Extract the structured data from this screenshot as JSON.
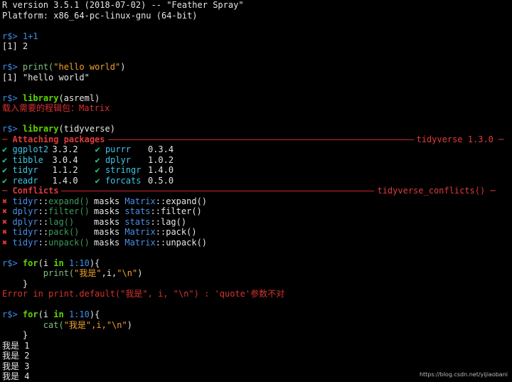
{
  "banner": {
    "version_line": "R version 3.5.1 (2018-07-02) -- \"Feather Spray\"",
    "platform_line": "Platform: x86_64-pc-linux-gnu (64-bit)"
  },
  "prompt": "r$>",
  "session": {
    "cmd1": "1+1",
    "out1": "[1] 2",
    "cmd2_fn": "print(",
    "cmd2_str": "\"hello world\"",
    "cmd2_close": ")",
    "out2": "[1] \"hello world\"",
    "cmd3_fn": "library",
    "cmd3_arg": "(asreml)",
    "out3_msg": "载入需要的程辑包：Matrix",
    "cmd4_fn": "library",
    "cmd4_arg": "(tidyverse)"
  },
  "attaching": {
    "title": "─ Attaching packages",
    "right": "tidyverse 1.3.0 ─",
    "check": "✔",
    "packages": [
      {
        "name": "ggplot2",
        "version": "3.3.2"
      },
      {
        "name": "tibble",
        "version": "3.0.4"
      },
      {
        "name": "tidyr",
        "version": "1.1.2"
      },
      {
        "name": "readr",
        "version": "1.4.0"
      },
      {
        "name": "purrr",
        "version": "0.3.4"
      },
      {
        "name": "dplyr",
        "version": "1.0.2"
      },
      {
        "name": "stringr",
        "version": "1.4.0"
      },
      {
        "name": "forcats",
        "version": "0.5.0"
      }
    ]
  },
  "conflicts": {
    "title": "─ Conflicts",
    "right": "tidyverse_conflicts() ─",
    "cross": "✖",
    "masks_word": "masks",
    "rows": [
      {
        "pkg": "tidyr",
        "fn": "expand()",
        "mpkg": "Matrix",
        "mfn": "expand()"
      },
      {
        "pkg": "dplyr",
        "fn": "filter()",
        "mpkg": "stats",
        "mfn": "filter()"
      },
      {
        "pkg": "dplyr",
        "fn": "lag()",
        "mpkg": "stats",
        "mfn": "lag()"
      },
      {
        "pkg": "tidyr",
        "fn": "pack()",
        "mpkg": "Matrix",
        "mfn": "pack()"
      },
      {
        "pkg": "tidyr",
        "fn": "unpack()",
        "mpkg": "Matrix",
        "mfn": "unpack()"
      }
    ]
  },
  "loop1": {
    "for_kw": "for",
    "open": "(i ",
    "in_kw": "in",
    "range": "1:10",
    "close": "){",
    "body_fn": "print(",
    "body_str1": "\"我是\"",
    "body_mid": ",i,",
    "body_str2": "\"\\n\"",
    "body_close": ")",
    "end": "}",
    "error": "Error in print.default(\"我是\", i, \"\\n\") : 'quote'参数不对"
  },
  "loop2": {
    "for_kw": "for",
    "open": "(i ",
    "in_kw": "in",
    "range": "1:10",
    "close": "){",
    "body_fn": "cat(",
    "body_str": "\"我是\",i,\"\\n\"",
    "body_close": ")",
    "end": "}",
    "outputs": [
      "我是 1",
      "我是 2",
      "我是 3",
      "我是 4"
    ]
  },
  "watermark": "https://blog.csdn.net/yijiaobani",
  "colors": {
    "background": "#000000",
    "prompt": "#3b8eea",
    "keyword": "#5fd700",
    "string": "#f0a22a",
    "error": "#d83131",
    "check": "#23d18b",
    "package": "#3ec4e8",
    "rule": "#c8262a"
  }
}
